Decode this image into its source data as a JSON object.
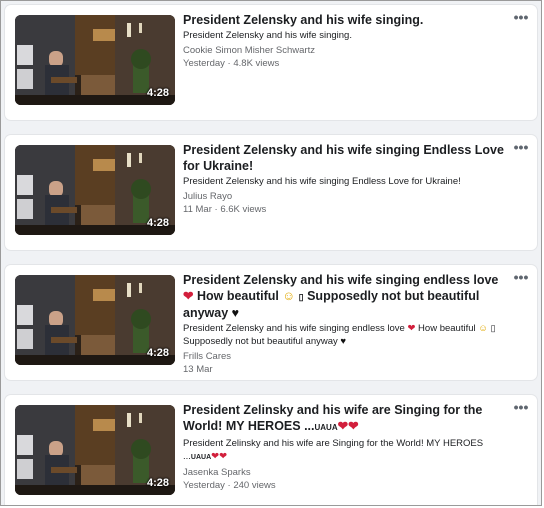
{
  "videos": [
    {
      "title": "President Zelensky and his wife singing.",
      "description": "President Zelensky and his wife singing.",
      "channel": "Cookie Simon Misher Schwartz",
      "date": "Yesterday",
      "views": "4.8K views",
      "duration": "4:28"
    },
    {
      "title": "President Zelensky and his wife singing Endless Love for Ukraine!",
      "description": "President Zelensky and his wife singing Endless Love for Ukraine!",
      "channel": "Julius Rayo",
      "date": "11 Mar",
      "views": "6.6K views",
      "duration": "4:28"
    },
    {
      "title_part1": "President Zelensky and his wife singing endless love",
      "title_part2": "How beautiful",
      "title_part3": "Supposedly not but beautiful anyway",
      "desc_part1": "President Zelensky and his wife singing endless love",
      "desc_part2": "How beautiful",
      "desc_part3": "Supposedly not but beautiful anyway",
      "channel": "Frills Cares",
      "date": "13 Mar",
      "duration": "4:28"
    },
    {
      "title_part1": "President Zelinsky and his wife are Singing for the World! MY HEROES ...",
      "title_tag": "UAUA",
      "desc_part1": "President Zelinsky and his wife are Singing for the World! MY HEROES ...",
      "desc_tag": "UAUA",
      "channel": "Jasenka Sparks",
      "date": "Yesterday",
      "views": "240 views",
      "duration": "4:28"
    }
  ],
  "separator": "·",
  "more_label": "•••",
  "glyphs": {
    "heart": "❤",
    "black_heart": "♥",
    "smiley": "☺",
    "box": "▯"
  },
  "colors": {
    "title": "#1c1e21",
    "meta": "#65676b",
    "background": "#f0f2f5",
    "heart": "#d21f3c"
  }
}
